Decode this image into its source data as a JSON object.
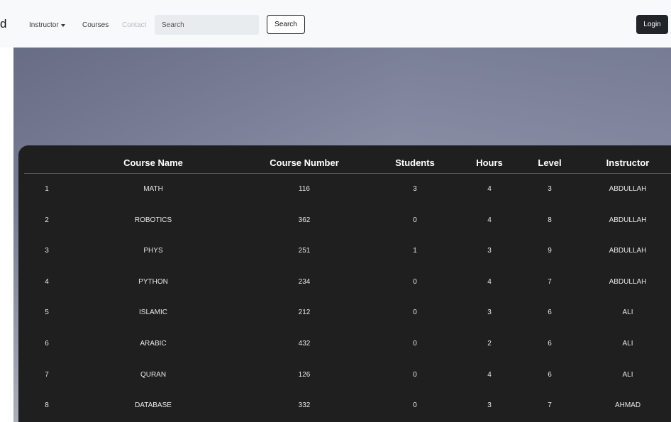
{
  "navbar": {
    "brand": "d",
    "links": {
      "instructor": "Instructor",
      "courses": "Courses",
      "contact": "Contact"
    },
    "search": {
      "placeholder": "Search",
      "button_label": "Search"
    },
    "login_label": "Login"
  },
  "table": {
    "headers": [
      "",
      "Course Name",
      "Course Number",
      "Students",
      "Hours",
      "Level",
      "Instructor"
    ],
    "rows": [
      [
        "1",
        "MATH",
        "116",
        "3",
        "4",
        "3",
        "ABDULLAH"
      ],
      [
        "2",
        "ROBOTICS",
        "362",
        "0",
        "4",
        "8",
        "ABDULLAH"
      ],
      [
        "3",
        "PHYS",
        "251",
        "1",
        "3",
        "9",
        "ABDULLAH"
      ],
      [
        "4",
        "PYTHON",
        "234",
        "0",
        "4",
        "7",
        "ABDULLAH"
      ],
      [
        "5",
        "ISLAMIC",
        "212",
        "0",
        "3",
        "6",
        "ALI"
      ],
      [
        "6",
        "ARABIC",
        "432",
        "0",
        "2",
        "6",
        "ALI"
      ],
      [
        "7",
        "QURAN",
        "126",
        "0",
        "4",
        "6",
        "ALI"
      ],
      [
        "8",
        "DATABASE",
        "332",
        "0",
        "3",
        "7",
        "AHMAD"
      ]
    ]
  },
  "colors": {
    "navbar_bg": "#f8f9fa",
    "table_bg": "#1f1f20",
    "login_bg": "#212529",
    "contact_link": "#b9bcc0"
  },
  "icons": {
    "instructor_dropdown": "caret-down-icon"
  }
}
